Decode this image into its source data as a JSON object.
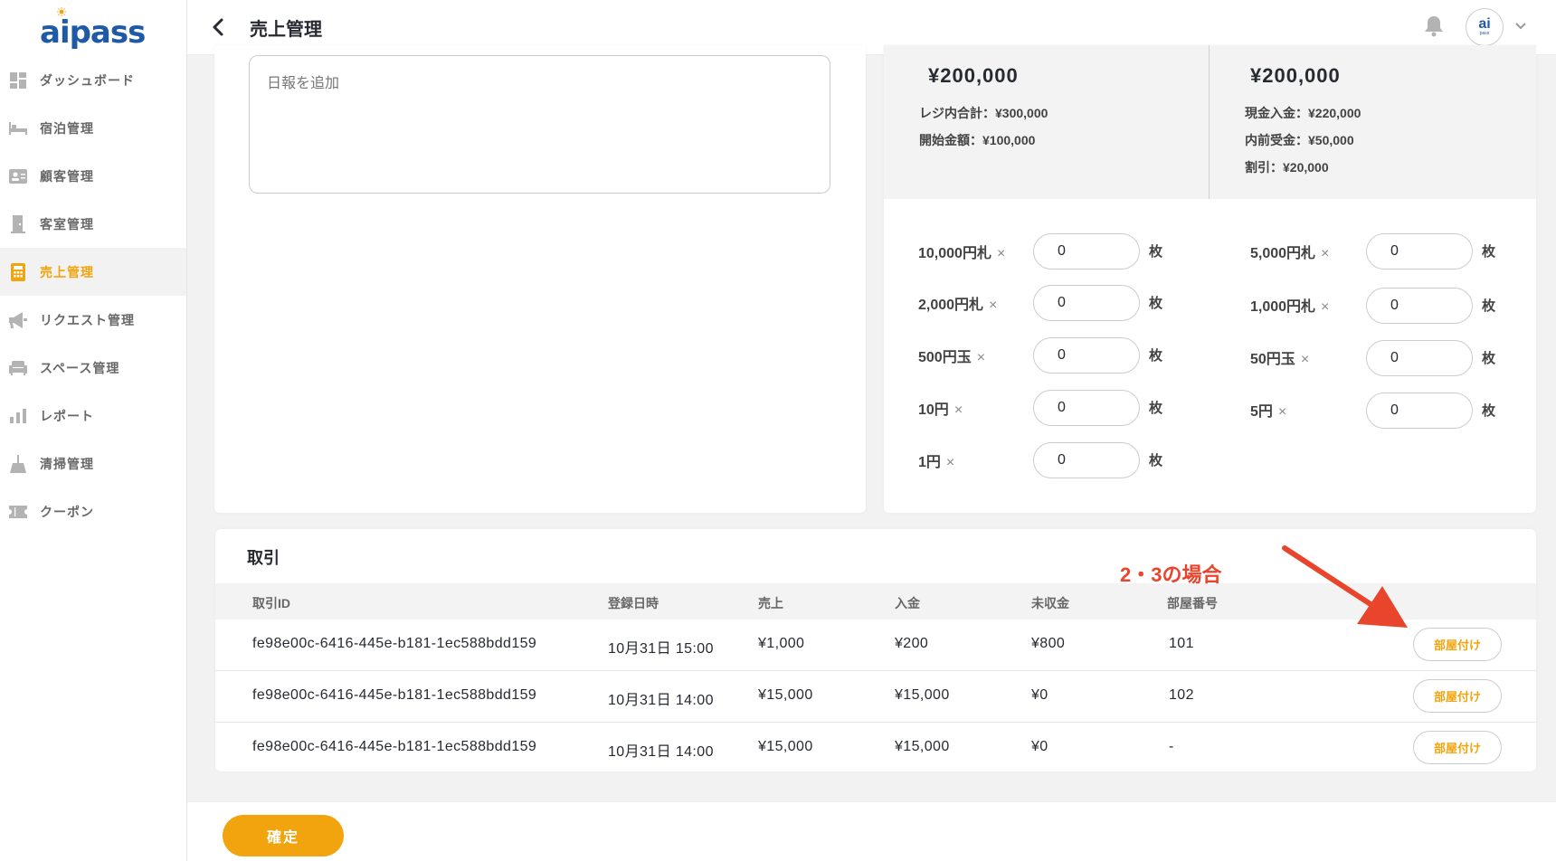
{
  "app": {
    "logo_text": "aipass"
  },
  "sidebar": {
    "items": [
      {
        "label": "ダッシュボード",
        "icon": "dashboard-icon"
      },
      {
        "label": "宿泊管理",
        "icon": "bed-icon"
      },
      {
        "label": "顧客管理",
        "icon": "customer-card-icon"
      },
      {
        "label": "客室管理",
        "icon": "door-icon"
      },
      {
        "label": "売上管理",
        "icon": "calculator-icon",
        "active": true
      },
      {
        "label": "リクエスト管理",
        "icon": "megaphone-icon"
      },
      {
        "label": "スペース管理",
        "icon": "sofa-icon"
      },
      {
        "label": "レポート",
        "icon": "bar-chart-icon"
      },
      {
        "label": "清掃管理",
        "icon": "broom-icon"
      },
      {
        "label": "クーポン",
        "icon": "ticket-icon"
      }
    ]
  },
  "header": {
    "title": "売上管理",
    "avatar_text": "ai",
    "avatar_subtext": "pass"
  },
  "report": {
    "placeholder": "日報を追加"
  },
  "summary": {
    "left": {
      "total": "¥200,000",
      "lines": [
        "レジ内合計：¥300,000",
        "開始金額：¥100,000"
      ]
    },
    "right": {
      "total": "¥200,000",
      "lines": [
        "現金入金：¥220,000",
        "内前受金：¥50,000",
        "割引：¥20,000"
      ]
    }
  },
  "denominations": {
    "multiply": "×",
    "unit": "枚",
    "left": [
      {
        "label": "10,000円札",
        "value": "0"
      },
      {
        "label": "2,000円札",
        "value": "0"
      },
      {
        "label": "500円玉",
        "value": "0"
      },
      {
        "label": "10円",
        "value": "0"
      },
      {
        "label": "1円",
        "value": "0"
      }
    ],
    "right": [
      {
        "label": "5,000円札",
        "value": "0"
      },
      {
        "label": "1,000円札",
        "value": "0"
      },
      {
        "label": "50円玉",
        "value": "0"
      },
      {
        "label": "5円",
        "value": "0"
      }
    ]
  },
  "transactions": {
    "title": "取引",
    "columns": [
      "取引ID",
      "登録日時",
      "売上",
      "入金",
      "未収金",
      "部屋番号"
    ],
    "rows": [
      {
        "id": "fe98e00c-6416-445e-b181-1ec588bdd159",
        "date": "10月31日 15:00",
        "sales": "¥1,000",
        "payment": "¥200",
        "receivable": "¥800",
        "room": "101",
        "action": "部屋付け"
      },
      {
        "id": "fe98e00c-6416-445e-b181-1ec588bdd159",
        "date": "10月31日 14:00",
        "sales": "¥15,000",
        "payment": "¥15,000",
        "receivable": "¥0",
        "room": "102",
        "action": "部屋付け"
      },
      {
        "id": "fe98e00c-6416-445e-b181-1ec588bdd159",
        "date": "10月31日 14:00",
        "sales": "¥15,000",
        "payment": "¥15,000",
        "receivable": "¥0",
        "room": "-",
        "action": "部屋付け"
      }
    ]
  },
  "annotation": {
    "text": "2・3の場合",
    "color": "#e8452c"
  },
  "footer": {
    "confirm_label": "確定"
  },
  "colors": {
    "accent": "#f2a40e",
    "brand": "#1f5aa6",
    "annotation": "#e8452c"
  }
}
